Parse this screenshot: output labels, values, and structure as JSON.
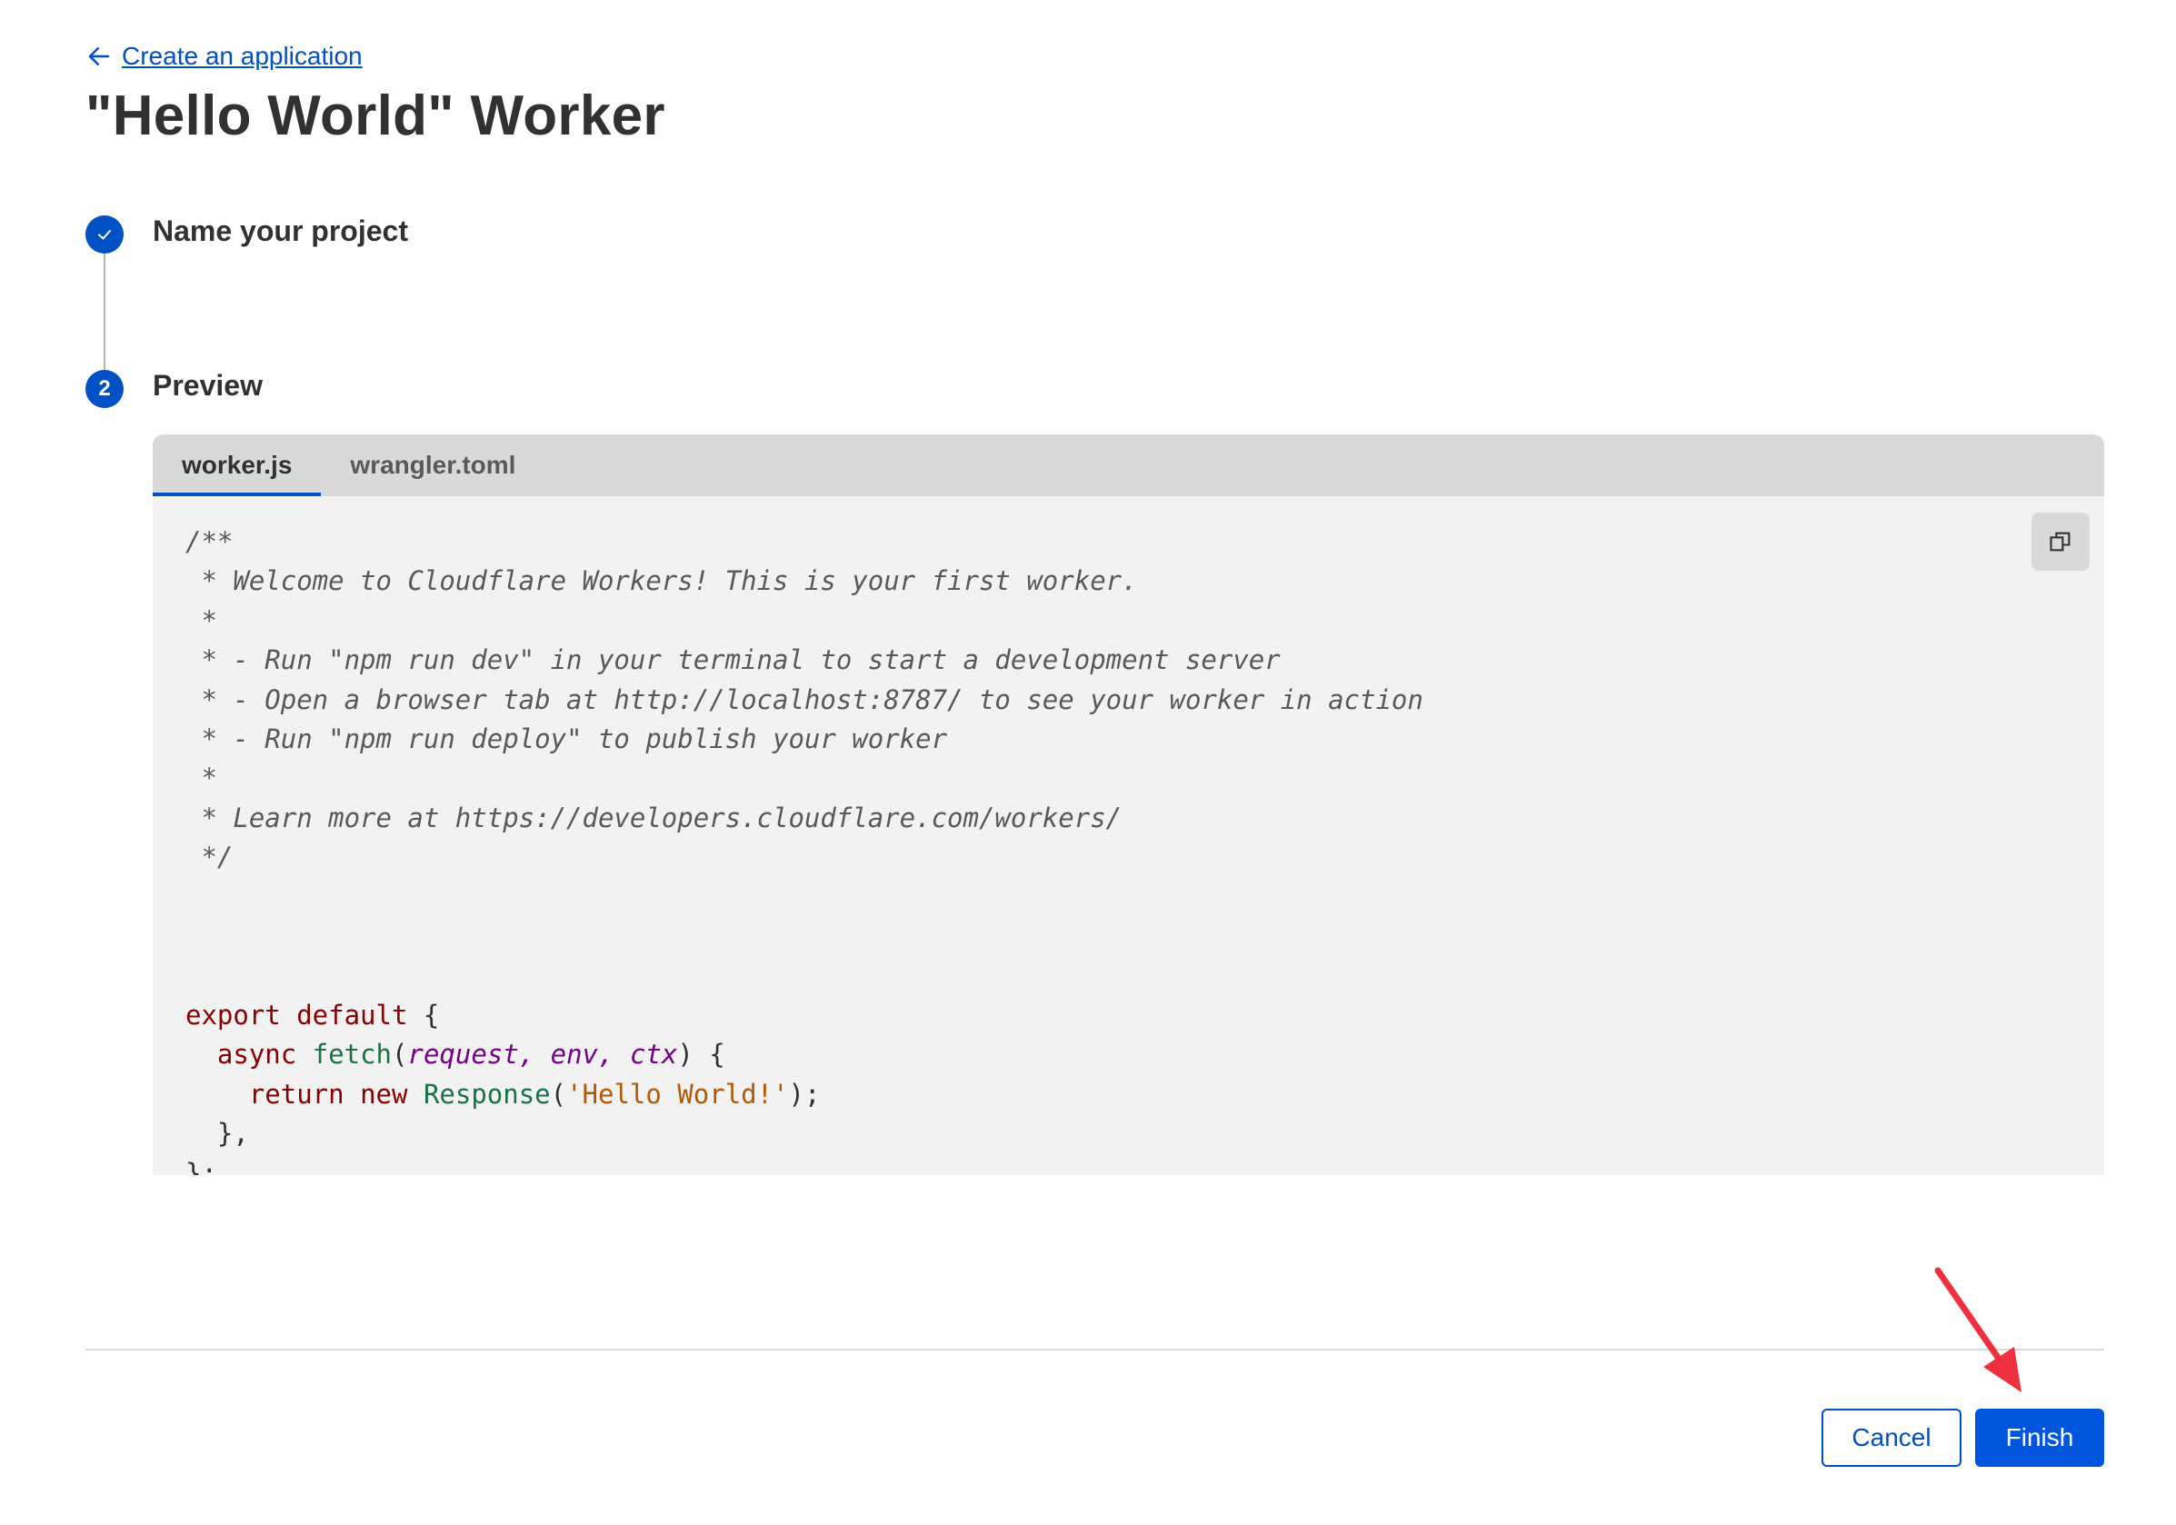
{
  "header": {
    "back_link": "Create an application",
    "title": "\"Hello World\" Worker"
  },
  "steps": [
    {
      "indicator": "check-icon",
      "label": "Name your project",
      "status": "completed"
    },
    {
      "indicator": "2",
      "label": "Preview",
      "status": "active"
    }
  ],
  "preview": {
    "tabs": [
      "worker.js",
      "wrangler.toml"
    ],
    "active_tab": "worker.js",
    "copy_icon": "copy-icon",
    "code": {
      "comment": "/**\n * Welcome to Cloudflare Workers! This is your first worker.\n *\n * - Run \"npm run dev\" in your terminal to start a development server\n * - Open a browser tab at http://localhost:8787/ to see your worker in action\n * - Run \"npm run deploy\" to publish your worker\n *\n * Learn more at https://developers.cloudflare.com/workers/\n */",
      "export_default": "export default",
      "async": "async",
      "fetch": "fetch",
      "param_request": "request",
      "param_env": "env",
      "param_ctx": "ctx",
      "return": "return",
      "new": "new",
      "response": "Response",
      "string": "'Hello World!'"
    }
  },
  "footer": {
    "cancel": "Cancel",
    "finish": "Finish"
  },
  "colors": {
    "accent": "#0051c3",
    "annotation_arrow": "#f0303f"
  }
}
